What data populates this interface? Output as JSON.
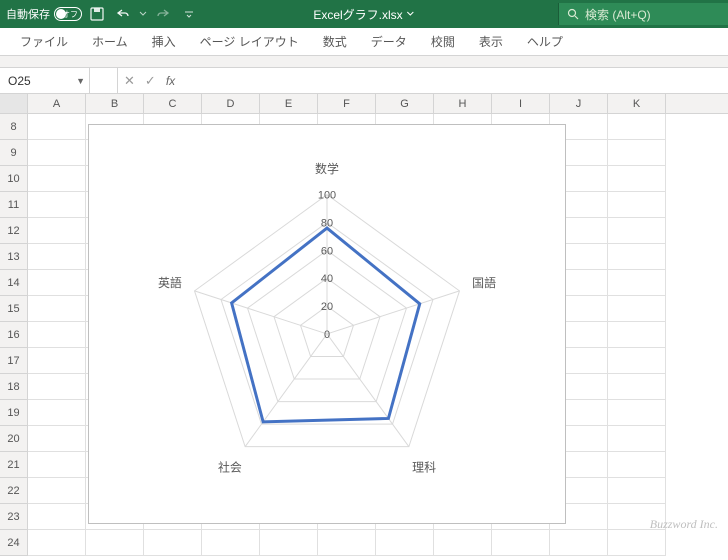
{
  "titlebar": {
    "autosave_label": "自動保存",
    "autosave_state": "オフ",
    "filename": "Excelグラフ.xlsx",
    "search_placeholder": "検索 (Alt+Q)"
  },
  "ribbon": {
    "tabs": [
      "ファイル",
      "ホーム",
      "挿入",
      "ページ レイアウト",
      "数式",
      "データ",
      "校閲",
      "表示",
      "ヘルプ"
    ]
  },
  "formulabar": {
    "namebox": "O25",
    "fx_label": "fx"
  },
  "grid": {
    "columns": [
      "A",
      "B",
      "C",
      "D",
      "E",
      "F",
      "G",
      "H",
      "I",
      "J",
      "K"
    ],
    "row_start": 8,
    "row_end": 24
  },
  "chart_data": {
    "type": "radar",
    "categories": [
      "数学",
      "国語",
      "理科",
      "社会",
      "英語"
    ],
    "values": [
      76,
      70,
      75,
      78,
      72
    ],
    "ticks": [
      0,
      20,
      40,
      60,
      80,
      100
    ],
    "max": 100
  },
  "watermark": "Buzzword Inc."
}
